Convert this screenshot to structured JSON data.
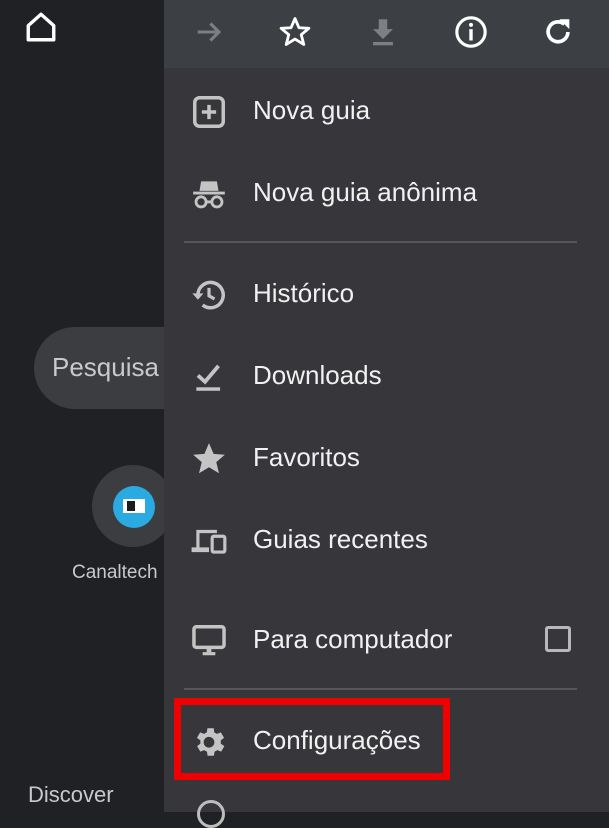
{
  "background_page": {
    "search_placeholder": "Pesquisa",
    "shortcut_tile_label": "Canaltech",
    "discover_label": "Discover",
    "home_icon": "home-icon"
  },
  "menu": {
    "toolbar": [
      {
        "name": "forward-button",
        "icon": "arrow-right-icon",
        "enabled": false
      },
      {
        "name": "bookmark-button",
        "icon": "star-outline-icon",
        "enabled": true
      },
      {
        "name": "download-page-button",
        "icon": "download-icon",
        "enabled": false
      },
      {
        "name": "page-info-button",
        "icon": "info-icon",
        "enabled": true
      },
      {
        "name": "reload-button",
        "icon": "refresh-icon",
        "enabled": true
      }
    ],
    "items": [
      {
        "label": "Nova guia",
        "icon": "new-tab-icon"
      },
      {
        "label": "Nova guia anônima",
        "icon": "incognito-icon"
      },
      {
        "label": "Histórico",
        "icon": "history-icon"
      },
      {
        "label": "Downloads",
        "icon": "downloads-check-icon"
      },
      {
        "label": "Favoritos",
        "icon": "star-icon"
      },
      {
        "label": "Guias recentes",
        "icon": "devices-icon"
      },
      {
        "label": "Para computador",
        "icon": "desktop-icon",
        "checked": false
      },
      {
        "label": "Configurações",
        "icon": "gear-icon",
        "highlighted": true
      }
    ],
    "highlight_color": "#f00000"
  }
}
